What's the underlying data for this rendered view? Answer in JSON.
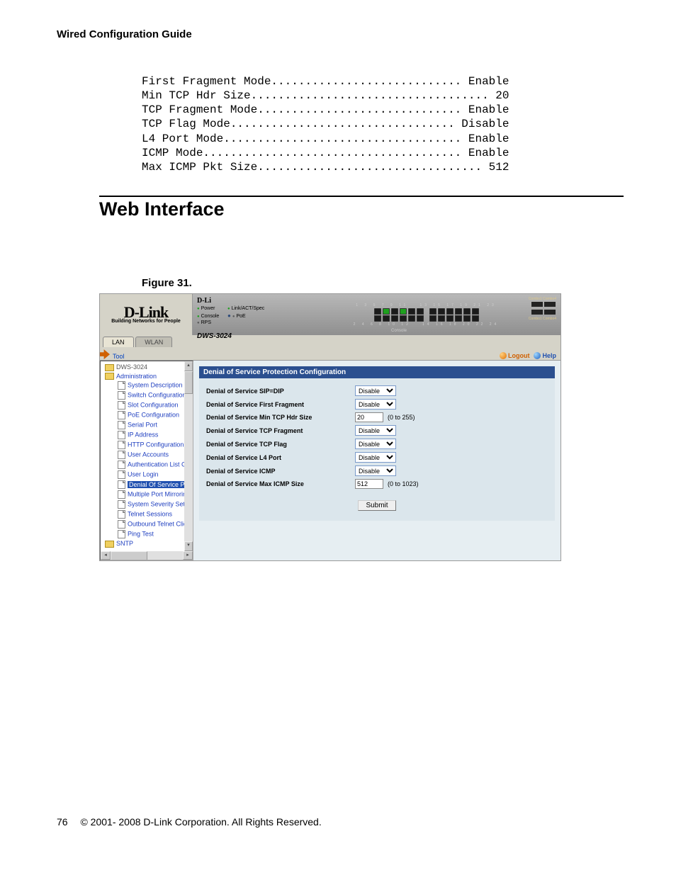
{
  "doc": {
    "guide_title": "Wired Configuration Guide",
    "section_heading": "Web Interface",
    "figure_caption": "Figure 31.",
    "page_number": "76",
    "copyright": "© 2001- 2008 D-Link Corporation. All Rights Reserved."
  },
  "cli_output": {
    "first_fragment_mode": {
      "label": "First Fragment Mode",
      "value": "Enable"
    },
    "min_tcp_hdr_size": {
      "label": "Min TCP Hdr Size",
      "value": "20"
    },
    "tcp_fragment_mode": {
      "label": "TCP Fragment Mode",
      "value": "Enable"
    },
    "tcp_flag_mode": {
      "label": "TCP Flag Mode",
      "value": "Disable"
    },
    "l4_port_mode": {
      "label": "L4 Port Mode",
      "value": "Enable"
    },
    "icmp_mode": {
      "label": "ICMP Mode",
      "value": "Enable"
    },
    "max_icmp_pkt_size": {
      "label": "Max ICMP Pkt Size",
      "value": "512"
    }
  },
  "ui": {
    "logo_brand": "D-Link",
    "logo_tagline": "Building Networks for People",
    "device_model": "DWS-3024",
    "leds": {
      "power": "Power",
      "console": "Console",
      "rps": "RPS",
      "link": "Link/ACT/Spec",
      "poe": "PoE"
    },
    "console_label": "Console",
    "combo_label": "Combo1 Combo4",
    "toolbar": {
      "tool": "Tool",
      "logout": "Logout",
      "help": "Help"
    },
    "tabs": {
      "lan": "LAN",
      "wlan": "WLAN"
    },
    "tree": {
      "root": "DWS-3024",
      "administration": "Administration",
      "items": [
        "System Description",
        "Switch Configuration",
        "Slot Configuration",
        "PoE Configuration",
        "Serial Port",
        "IP Address",
        "HTTP Configuration",
        "User Accounts",
        "Authentication List Con",
        "User Login",
        "Denial Of Service Prot",
        "Multiple Port Mirroring",
        "System Severity Settin",
        "Telnet Sessions",
        "Outbound Telnet Clien",
        "Ping Test"
      ],
      "sntp": "SNTP"
    },
    "panel": {
      "title": "Denial of Service Protection Configuration",
      "rows": {
        "sip_dip": {
          "label": "Denial of Service SIP=DIP",
          "value": "Disable"
        },
        "first_frag": {
          "label": "Denial of Service First Fragment",
          "value": "Disable"
        },
        "min_tcp": {
          "label": "Denial of Service Min TCP Hdr Size",
          "value": "20",
          "hint": "(0 to 255)"
        },
        "tcp_frag": {
          "label": "Denial of Service TCP Fragment",
          "value": "Disable"
        },
        "tcp_flag": {
          "label": "Denial of Service TCP Flag",
          "value": "Disable"
        },
        "l4_port": {
          "label": "Denial of Service L4 Port",
          "value": "Disable"
        },
        "icmp": {
          "label": "Denial of Service ICMP",
          "value": "Disable"
        },
        "max_icmp": {
          "label": "Denial of Service Max ICMP Size",
          "value": "512",
          "hint": "(0 to 1023)"
        }
      },
      "submit": "Submit"
    }
  }
}
